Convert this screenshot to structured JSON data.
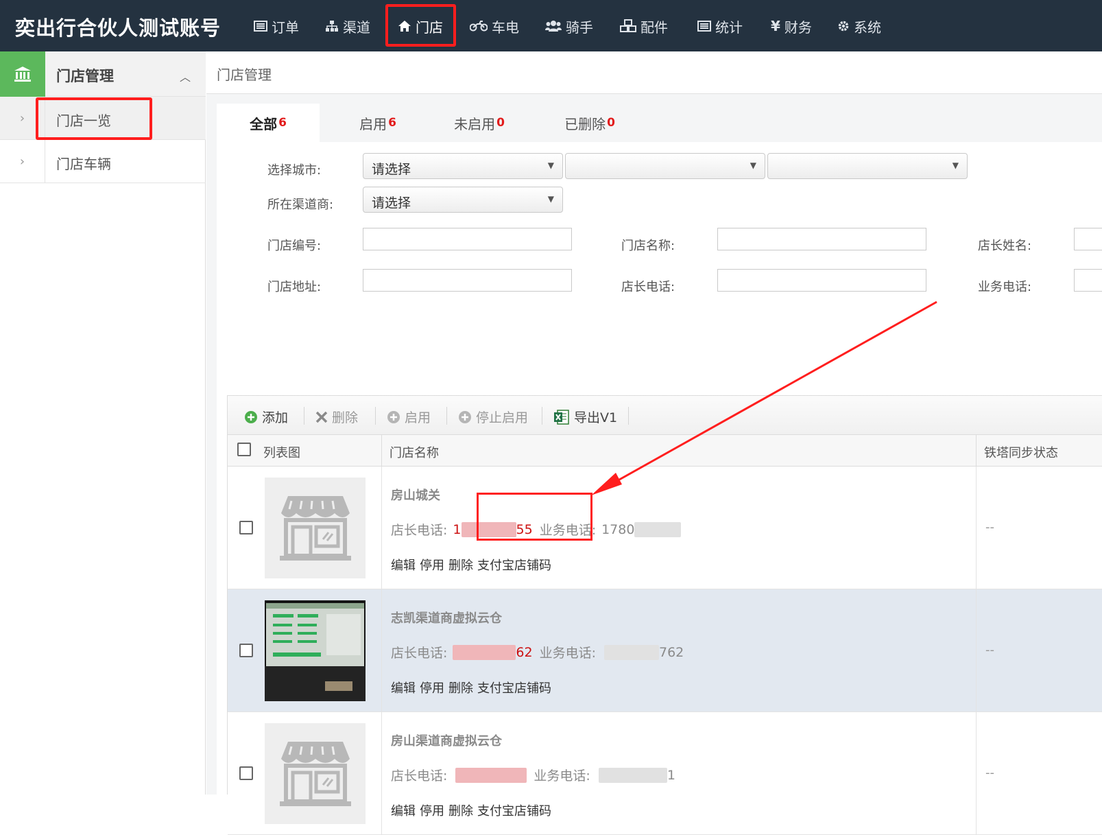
{
  "header": {
    "brand": "奕出行合伙人测试账号",
    "nav": [
      {
        "label": "订单",
        "icon": "list-icon"
      },
      {
        "label": "渠道",
        "icon": "sitemap-icon"
      },
      {
        "label": "门店",
        "icon": "home-icon",
        "active": true
      },
      {
        "label": "车电",
        "icon": "motorcycle-icon"
      },
      {
        "label": "骑手",
        "icon": "users-icon"
      },
      {
        "label": "配件",
        "icon": "cubes-icon"
      },
      {
        "label": "统计",
        "icon": "list-icon"
      },
      {
        "label": "财务",
        "icon": "yen-icon"
      },
      {
        "label": "系统",
        "icon": "gear-icon"
      }
    ],
    "yen_symbol": "¥"
  },
  "sidebar": {
    "section_title": "门店管理",
    "section_icon": "bank-icon",
    "items": [
      {
        "label": "门店一览",
        "active": true
      },
      {
        "label": "门店车辆",
        "active": false
      }
    ]
  },
  "breadcrumb": {
    "title": "门店管理"
  },
  "tabs": [
    {
      "label": "全部",
      "count": "6",
      "active": true
    },
    {
      "label": "启用",
      "count": "6"
    },
    {
      "label": "未启用",
      "count": "0"
    },
    {
      "label": "已删除",
      "count": "0"
    }
  ],
  "filters": {
    "city_label": "选择城市:",
    "city_select": [
      "请选择",
      "",
      ""
    ],
    "channel_label": "所在渠道商:",
    "channel_select": "请选择",
    "store_no_label": "门店编号:",
    "store_name_label": "门店名称:",
    "manager_name_label": "店长姓名:",
    "address_label": "门店地址:",
    "manager_phone_label": "店长电话:",
    "business_phone_label": "业务电话:"
  },
  "toolbar": {
    "add": "添加",
    "delete": "删除",
    "enable": "启用",
    "disable": "停止启用",
    "export": "导出V1"
  },
  "table": {
    "columns": [
      "列表图",
      "门店名称",
      "铁塔同步状态"
    ],
    "manager_phone_prefix": "店长电话:",
    "business_phone_prefix": "业务电话:",
    "row_actions": [
      "编辑",
      "停用",
      "删除",
      "支付宝店铺码"
    ],
    "rows": [
      {
        "name": "房山城关",
        "manager_phone_start": "1",
        "manager_phone_end": "55",
        "business_phone_visible": "178",
        "business_phone_mid": "0",
        "sync_status": "--",
        "image": "store-placeholder"
      },
      {
        "name": "志凯渠道商虚拟云仓",
        "manager_phone_start": "",
        "manager_phone_end": "62",
        "business_phone_visible": "",
        "business_phone_end": "762",
        "sync_status": "--",
        "image": "photo",
        "highlighted": true
      },
      {
        "name": "房山渠道商虚拟云仓",
        "manager_phone_start": "",
        "manager_phone_end": "",
        "business_phone_visible": "",
        "business_phone_end": "1",
        "sync_status": "--",
        "image": "store-placeholder"
      }
    ]
  },
  "colors": {
    "topbar": "#243240",
    "accent_green": "#5cb85c",
    "count_red": "#e21b1b",
    "annotation_red": "#ff1e1e",
    "row_highlight": "#e2e8f0"
  }
}
